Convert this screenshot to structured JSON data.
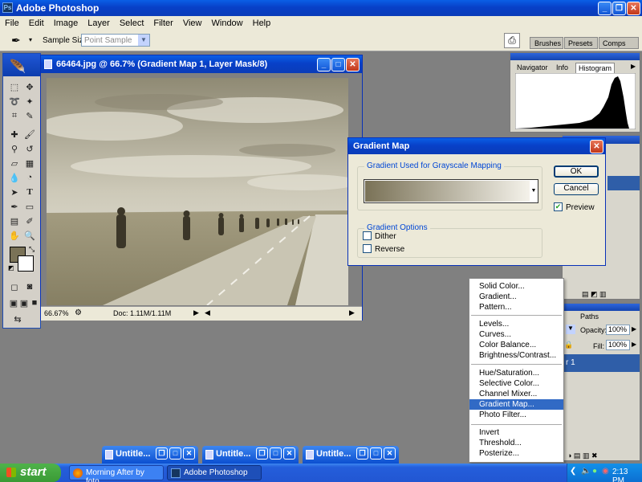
{
  "app": {
    "title": "Adobe Photoshop",
    "menu": [
      "File",
      "Edit",
      "Image",
      "Layer",
      "Select",
      "Filter",
      "View",
      "Window",
      "Help"
    ]
  },
  "options": {
    "sample_size_label": "Sample Size:",
    "sample_size_value": "Point Sample"
  },
  "well_tabs": [
    "Brushes",
    "Presets",
    "Comps"
  ],
  "doc": {
    "title": "66464.jpg @ 66.7% (Gradient Map 1, Layer Mask/8)",
    "zoom": "66.67%",
    "doc_info": "Doc: 1.11M/1.11M"
  },
  "histogram": {
    "tabs": [
      "Navigator",
      "Info",
      "Histogram"
    ]
  },
  "dialog": {
    "title": "Gradient Map",
    "group1": "Gradient Used for Grayscale Mapping",
    "group2": "Gradient Options",
    "dither": "Dither",
    "reverse": "Reverse",
    "ok": "OK",
    "cancel": "Cancel",
    "preview": "Preview",
    "dither_checked": false,
    "reverse_checked": false,
    "preview_checked": true,
    "colors": {
      "dark": "#7a7257",
      "light": "#f4f2ea"
    }
  },
  "layers": {
    "tab_paths": "Paths",
    "opacity_label": "Opacity:",
    "opacity": "100%",
    "fill_label": "Fill:",
    "fill": "100%",
    "layer_name": "r 1"
  },
  "context_menu": {
    "items": [
      "Solid Color...",
      "Gradient...",
      "Pattern...",
      "Levels...",
      "Curves...",
      "Color Balance...",
      "Brightness/Contrast...",
      "Hue/Saturation...",
      "Selective Color...",
      "Channel Mixer...",
      "Gradient Map...",
      "Photo Filter...",
      "Invert",
      "Threshold...",
      "Posterize..."
    ],
    "selected": "Gradient Map..."
  },
  "minimized": [
    "Untitle...",
    "Untitle...",
    "Untitle..."
  ],
  "taskbar": {
    "start": "start",
    "tasks": [
      "Morning After by foto...",
      "Adobe Photoshop"
    ],
    "clock": "2:13 PM"
  }
}
